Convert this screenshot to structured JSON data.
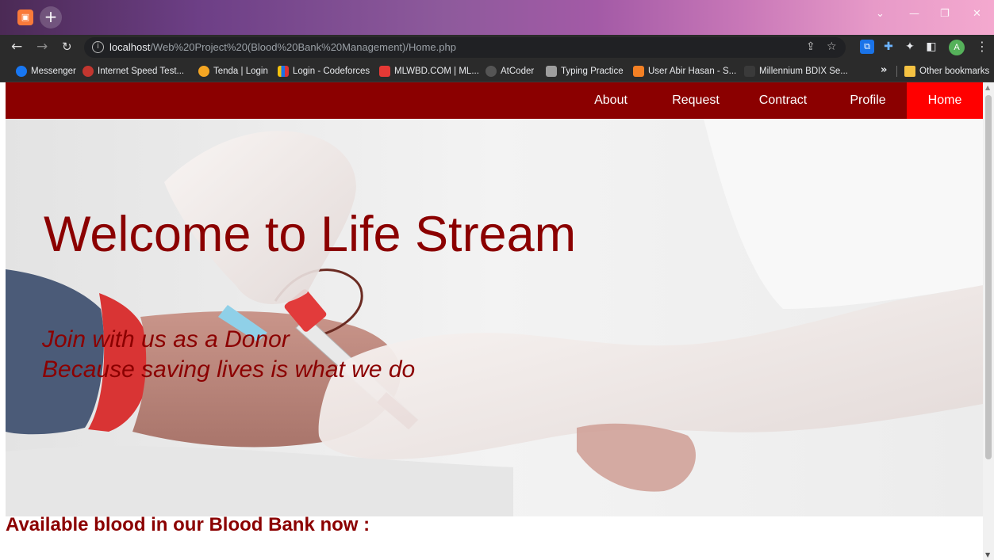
{
  "browser": {
    "app_tile_icon": "tab-search-icon",
    "new_tab_icon": "plus-icon",
    "url_host": "localhost",
    "url_path": "/Web%20Project%20(Blood%20Bank%20Management)/Home.php",
    "profile_initial": "A",
    "bookmarks": [
      {
        "label": "Messenger",
        "favicon_color": "#1877f2"
      },
      {
        "label": "Internet Speed Test...",
        "favicon_color": "#c2362f"
      },
      {
        "label": "Tenda | Login",
        "favicon_color": "#f5a623"
      },
      {
        "label": "Login - Codeforces",
        "favicon_color": "#1a73e8"
      },
      {
        "label": "MLWBD.COM | ML...",
        "favicon_color": "#e53935"
      },
      {
        "label": "AtCoder",
        "favicon_color": "#555555"
      },
      {
        "label": "Typing Practice",
        "favicon_color": "#9e9e9e"
      },
      {
        "label": "User Abir Hasan - S...",
        "favicon_color": "#f48024"
      },
      {
        "label": "Millennium BDIX Se...",
        "favicon_color": "#3a3a3a"
      }
    ],
    "overflow_label": "»",
    "other_bookmarks_label": "Other bookmarks"
  },
  "site_nav": {
    "items": [
      {
        "label": "About",
        "active": false
      },
      {
        "label": "Request",
        "active": false
      },
      {
        "label": "Contract",
        "active": false
      },
      {
        "label": "Profile",
        "active": false
      },
      {
        "label": "Home",
        "active": true
      }
    ]
  },
  "hero": {
    "title": "Welcome to Life Stream",
    "subtitle_line1": "Join with us as a Donor",
    "subtitle_line2": "Because saving lives is what we do"
  },
  "section": {
    "heading": "Available blood in our Blood Bank now :"
  },
  "colors": {
    "brand_dark_red": "#8b0000",
    "active_red": "#ff0000",
    "nav_text": "#ffffff"
  }
}
